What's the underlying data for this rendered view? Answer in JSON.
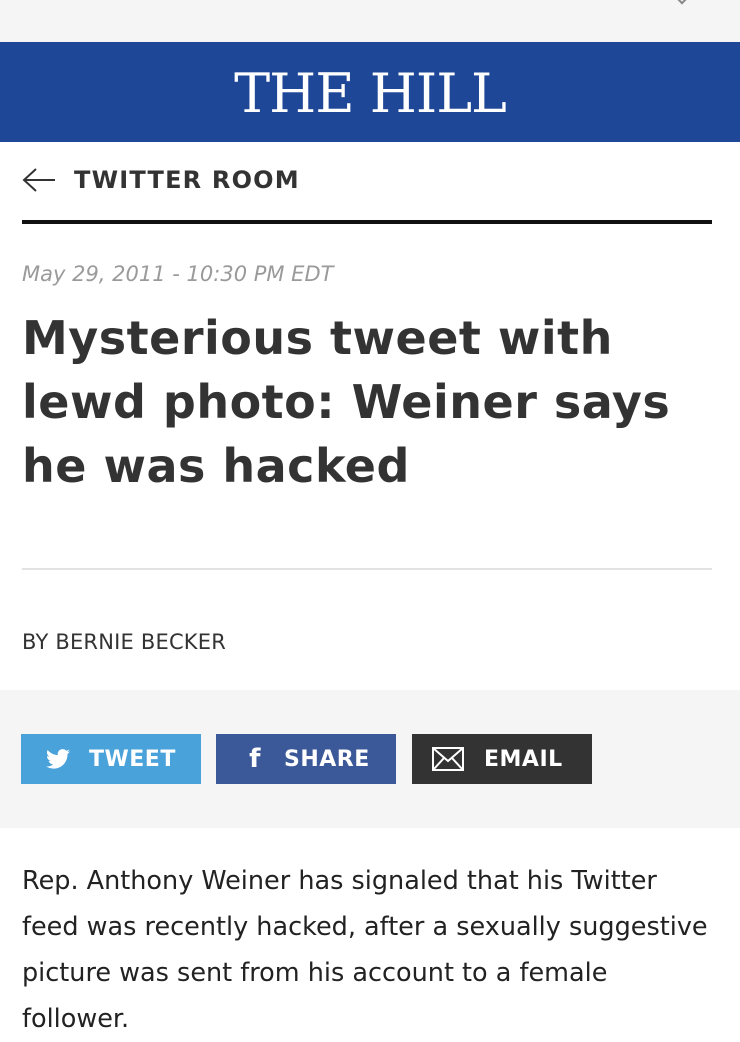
{
  "masthead": {
    "logo": "THE HILL",
    "background_color": "#1e4797"
  },
  "section": {
    "back_icon": "arrow-left-icon",
    "title": "TWITTER ROOM"
  },
  "article": {
    "date": "May 29, 2011 - 10:30 PM EDT",
    "headline": "Mysterious tweet with lewd photo: Weiner says he was hacked",
    "byline": "BY BERNIE BECKER",
    "body": "Rep. Anthony Weiner has signaled that his Twitter feed was recently hacked, after a sexually suggestive picture was sent from his account to a female follower."
  },
  "share": {
    "tweet_label": "TWEET",
    "tweet_icon": "twitter-bird-icon",
    "tweet_color": "#49a2da",
    "share_label": "SHARE",
    "share_icon": "facebook-icon",
    "share_color": "#3b5998",
    "email_label": "EMAIL",
    "email_icon": "envelope-icon",
    "email_color": "#333333"
  }
}
